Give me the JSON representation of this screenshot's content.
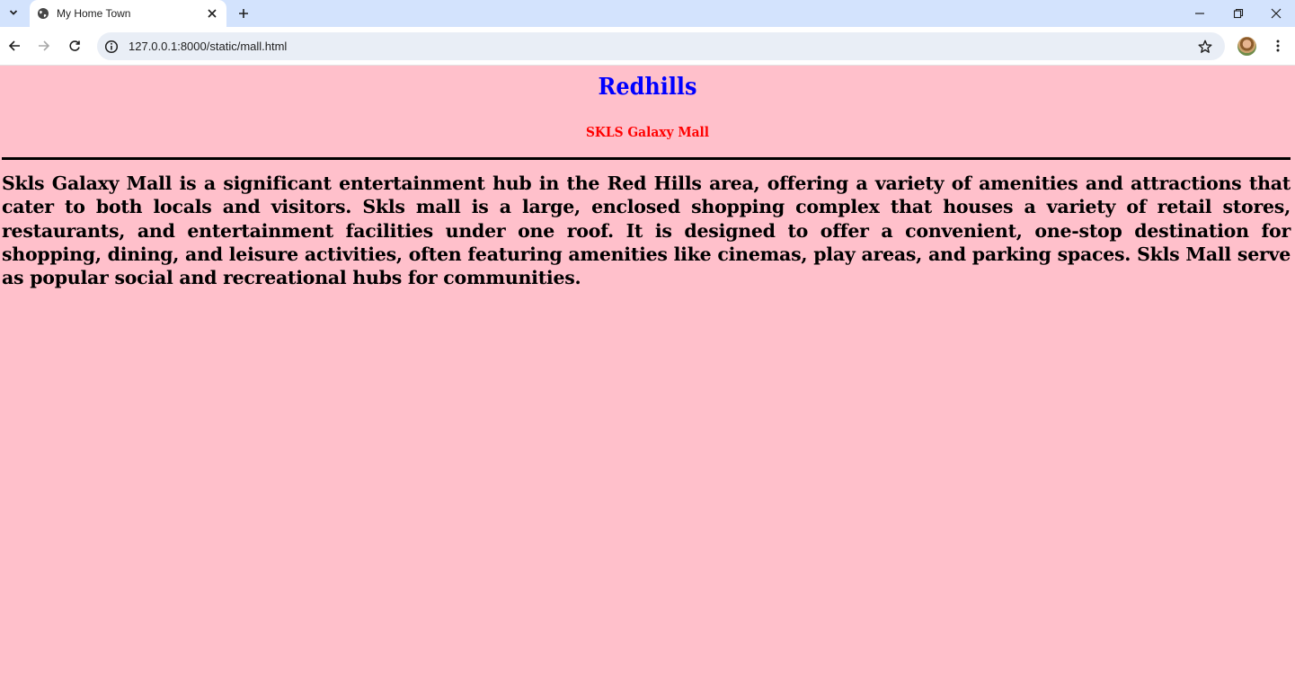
{
  "browser": {
    "tab_title": "My Home Town",
    "url": "127.0.0.1:8000/static/mall.html"
  },
  "page": {
    "heading": "Redhills",
    "subheading": "SKLS Galaxy Mall",
    "paragraph": "Skls Galaxy Mall is a significant entertainment hub in the Red Hills area, offering a variety of amenities and attractions that cater to both locals and visitors. Skls mall is a large, enclosed shopping complex that houses a variety of retail stores, restaurants, and entertainment facilities under one roof. It is designed to offer a convenient, one-stop destination for shopping, dining, and leisure activities, often featuring amenities like cinemas, play areas, and parking spaces. Skls Mall serve as popular social and recreational hubs for communities."
  },
  "colors": {
    "page_background": "#ffc0cb",
    "heading": "#0000ff",
    "subheading": "#ff0000",
    "tabstrip": "#d3e3fd"
  },
  "icons": {
    "tab_search": "chevron-down-icon",
    "favicon": "globe-icon",
    "tab_close": "close-icon",
    "new_tab": "plus-icon",
    "back": "arrow-left-icon",
    "forward": "arrow-right-icon",
    "reload": "reload-icon",
    "site_info": "info-icon",
    "bookmark": "star-icon",
    "menu": "kebab-menu-icon"
  }
}
